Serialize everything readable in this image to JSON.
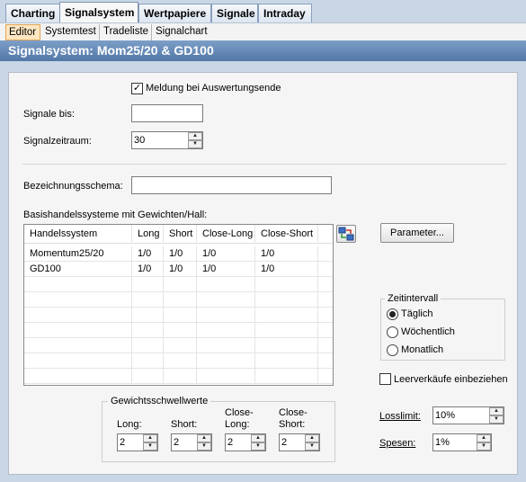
{
  "main_tabs": [
    "Charting",
    "Signalsystem",
    "Wertpapiere",
    "Signale",
    "Intraday"
  ],
  "sub_tabs": [
    "Editor",
    "Systemtest",
    "Tradeliste",
    "Signalchart"
  ],
  "title": "Signalsystem: Mom25/20 & GD100",
  "form": {
    "meldung_label": "Meldung bei Auswertungsende",
    "meldung_checked": true,
    "signale_bis_label": "Signale bis:",
    "signale_bis_value": "",
    "signalzeitraum_label": "Signalzeitraum:",
    "signalzeitraum_value": "30",
    "bezeichnungsschema_label": "Bezeichnungsschema:",
    "bezeichnungsschema_value": ""
  },
  "basis": {
    "label": "Basishandelssysteme mit Gewichten/Hall:",
    "columns": [
      "Handelssystem",
      "Long",
      "Short",
      "Close-Long",
      "Close-Short"
    ],
    "rows": [
      [
        "Momentum25/20",
        "1/0",
        "1/0",
        "1/0",
        "1/0"
      ],
      [
        "GD100",
        "1/0",
        "1/0",
        "1/0",
        "1/0"
      ]
    ]
  },
  "parameter_button": "Parameter...",
  "zeitintervall": {
    "legend": "Zeitintervall",
    "options": [
      "Täglich",
      "Wöchentlich",
      "Monatlich"
    ],
    "selected": "Täglich"
  },
  "leerverkaeufe": {
    "label": "Leerverkäufe einbeziehen",
    "checked": false
  },
  "gewicht": {
    "legend": "Gewichtsschwellwerte",
    "long_label": "Long:",
    "short_label": "Short:",
    "close_long_label_1": "Close-",
    "close_long_label_2": "Long:",
    "close_short_label_1": "Close-",
    "close_short_label_2": "Short:",
    "values": [
      "2",
      "2",
      "2",
      "2"
    ]
  },
  "losslimit": {
    "label": "Losslimit:",
    "value": "10%"
  },
  "spesen": {
    "label": "Spesen:",
    "value": "1%"
  },
  "icons": {
    "assign": "assign-systems-icon",
    "spin_up": "spin-up-icon",
    "spin_down": "spin-down-icon",
    "check": "checkmark-icon"
  }
}
